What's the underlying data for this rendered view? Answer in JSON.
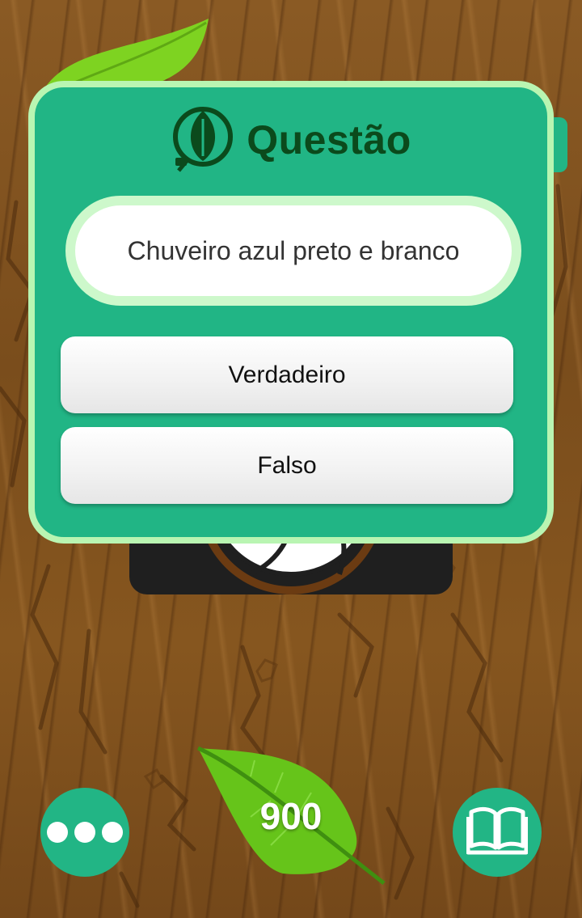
{
  "dialog": {
    "title": "Questão",
    "question": "Chuveiro azul preto e branco",
    "answers": [
      {
        "label": "Verdadeiro"
      },
      {
        "label": "Falso"
      }
    ]
  },
  "footer": {
    "score": "900",
    "menu_icon": "more-dots-icon",
    "book_icon": "open-book-icon"
  },
  "icons": {
    "logo": "leaf-plug-logo-icon"
  },
  "colors": {
    "panel": "#21b585",
    "panel_border": "#b9f5b2",
    "title": "#0b4a1c",
    "leaf": "#66c41a",
    "wood": "#7a4d1c"
  }
}
